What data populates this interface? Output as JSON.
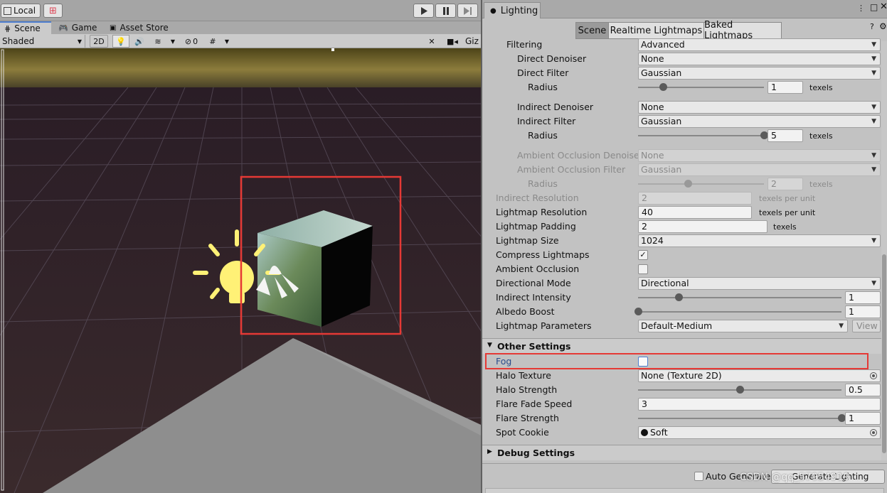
{
  "toolbar": {
    "local_label": "Local",
    "play_icon": "play-icon",
    "pause_icon": "pause-icon",
    "step_icon": "step-icon"
  },
  "scene_tabs": [
    {
      "label": "Scene",
      "icon": "scene-icon"
    },
    {
      "label": "Game",
      "icon": "gamepad-icon"
    },
    {
      "label": "Asset Store",
      "icon": "store-icon"
    }
  ],
  "scene_toolbar": {
    "draw_mode": "Shaded",
    "mode_2d": "2D",
    "hidden_count": "0",
    "gizmos_label": "Giz"
  },
  "lighting": {
    "window_title": "Lighting",
    "subtabs": [
      "Scene",
      "Realtime Lightmaps",
      "Baked Lightmaps"
    ],
    "active_subtab": "Scene",
    "filtering": {
      "label": "Filtering",
      "value": "Advanced"
    },
    "direct_denoiser": {
      "label": "Direct Denoiser",
      "value": "None"
    },
    "direct_filter": {
      "label": "Direct Filter",
      "value": "Gaussian"
    },
    "direct_radius": {
      "label": "Radius",
      "value": "1",
      "unit": "texels",
      "fraction": 0.2
    },
    "indirect_denoiser": {
      "label": "Indirect Denoiser",
      "value": "None"
    },
    "indirect_filter": {
      "label": "Indirect Filter",
      "value": "Gaussian"
    },
    "indirect_radius": {
      "label": "Radius",
      "value": "5",
      "unit": "texels",
      "fraction": 1.0
    },
    "ao_denoiser": {
      "label": "Ambient Occlusion Denoiser",
      "value": "None"
    },
    "ao_filter": {
      "label": "Ambient Occlusion Filter",
      "value": "Gaussian"
    },
    "ao_radius": {
      "label": "Radius",
      "value": "2",
      "unit": "texels",
      "fraction": 0.4
    },
    "indirect_resolution": {
      "label": "Indirect Resolution",
      "value": "2",
      "unit": "texels per unit"
    },
    "lightmap_resolution": {
      "label": "Lightmap Resolution",
      "value": "40",
      "unit": "texels per unit"
    },
    "lightmap_padding": {
      "label": "Lightmap Padding",
      "value": "2",
      "unit": "texels"
    },
    "lightmap_size": {
      "label": "Lightmap Size",
      "value": "1024"
    },
    "compress_lightmaps": {
      "label": "Compress Lightmaps",
      "checked": true,
      "mark": "✓"
    },
    "ambient_occlusion": {
      "label": "Ambient Occlusion",
      "checked": false
    },
    "directional_mode": {
      "label": "Directional Mode",
      "value": "Directional"
    },
    "indirect_intensity": {
      "label": "Indirect Intensity",
      "value": "1",
      "fraction": 0.2
    },
    "albedo_boost": {
      "label": "Albedo Boost",
      "value": "1",
      "fraction": 0.0
    },
    "lightmap_parameters": {
      "label": "Lightmap Parameters",
      "value": "Default-Medium",
      "view_label": "View"
    },
    "other_settings": {
      "title": "Other Settings",
      "fog": {
        "label": "Fog",
        "checked": false
      },
      "halo_texture": {
        "label": "Halo Texture",
        "value": "None (Texture 2D)"
      },
      "halo_strength": {
        "label": "Halo Strength",
        "value": "0.5",
        "fraction": 0.5
      },
      "flare_fade_speed": {
        "label": "Flare Fade Speed",
        "value": "3"
      },
      "flare_strength": {
        "label": "Flare Strength",
        "value": "1",
        "fraction": 1.0
      },
      "spot_cookie": {
        "label": "Spot Cookie",
        "value": "Soft"
      }
    },
    "debug_settings": {
      "title": "Debug Settings"
    },
    "auto_generate": {
      "label": "Auto Generate",
      "checked": false
    },
    "generate_button": "Generate Lighting"
  },
  "watermark": "CSDN @qq_57954919",
  "colors": {
    "highlight_red": "#e53935",
    "accent_blue": "#4f7fcf"
  }
}
